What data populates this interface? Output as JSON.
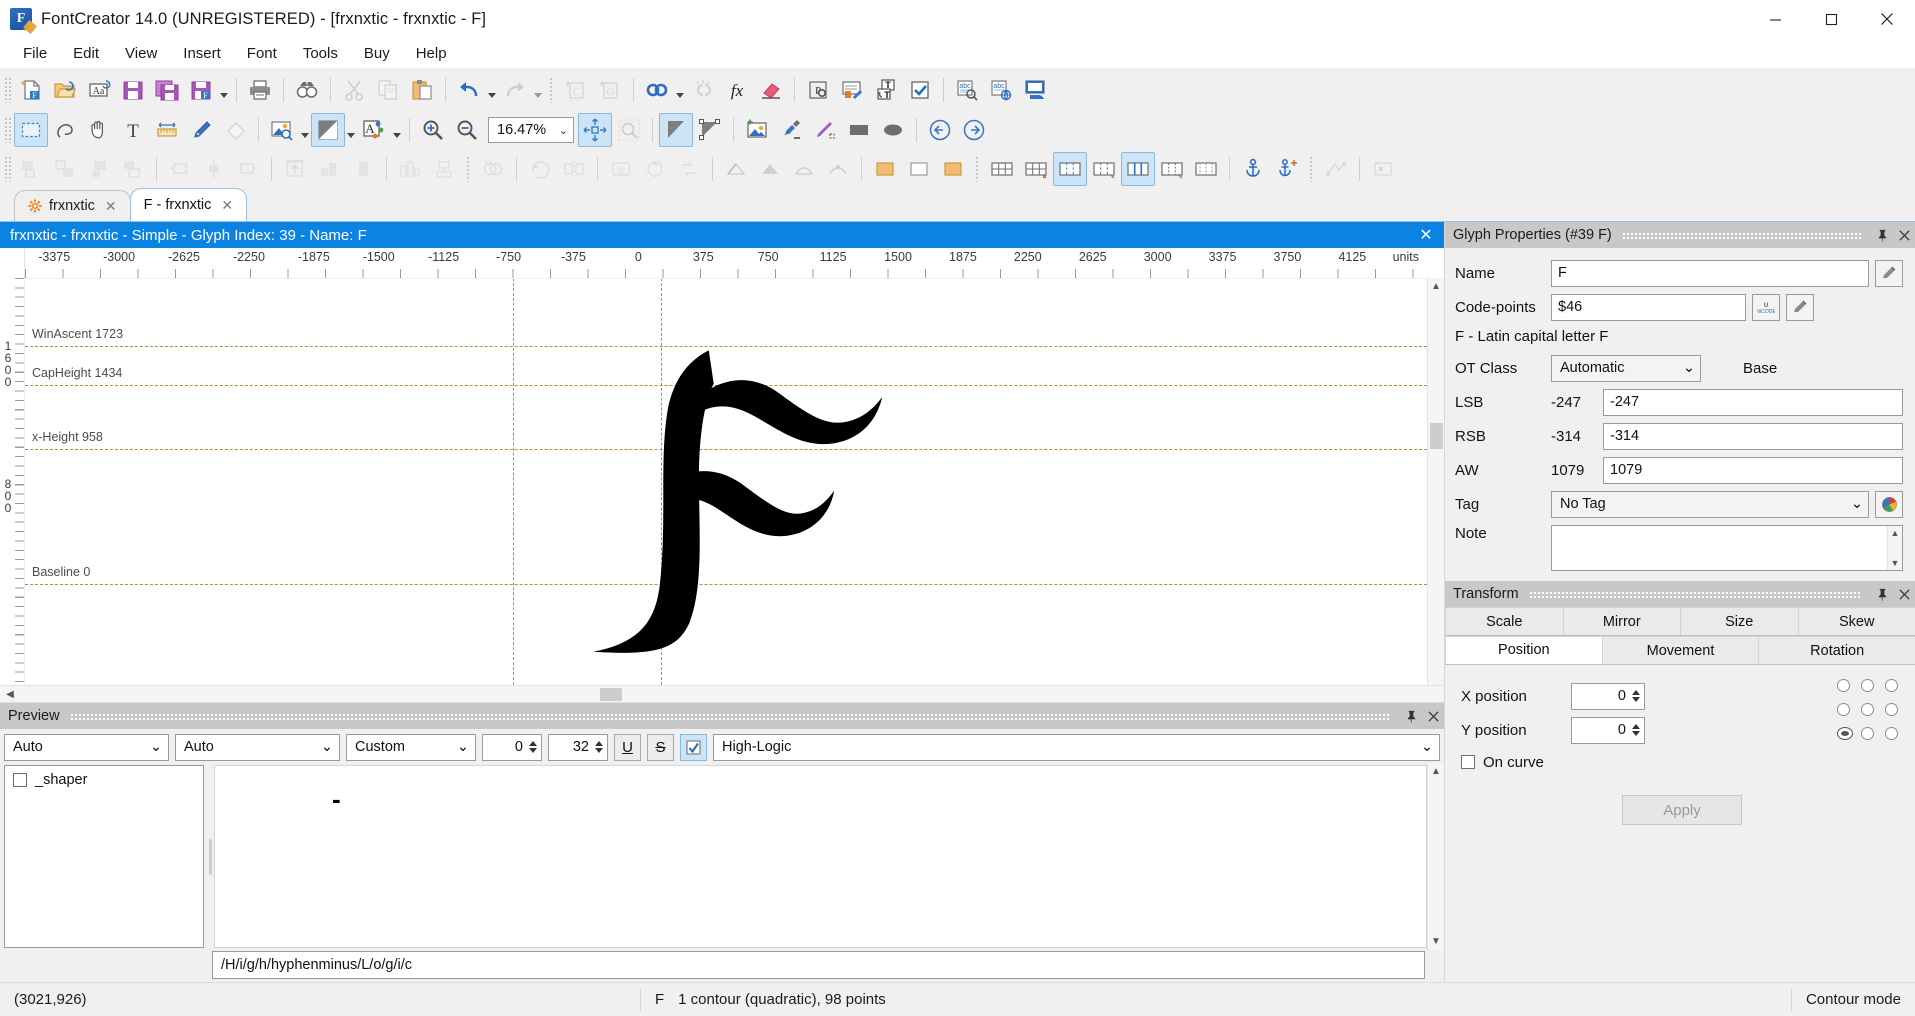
{
  "window": {
    "title": "FontCreator 14.0 (UNREGISTERED) - [frxnxtic - frxnxtic - F]",
    "app_icon": "F",
    "minimize": "minimize-button",
    "maximize": "maximize-button",
    "close": "close-button"
  },
  "menu": [
    "File",
    "Edit",
    "View",
    "Insert",
    "Font",
    "Tools",
    "Buy",
    "Help"
  ],
  "toolbar_row1": [
    {
      "name": "new-font-icon",
      "disabled": false
    },
    {
      "name": "open-font-icon",
      "disabled": false
    },
    {
      "name": "font-name-icon",
      "disabled": false
    },
    {
      "name": "save-icon",
      "disabled": false
    },
    {
      "name": "save-all-icon",
      "disabled": false
    },
    {
      "name": "save-as-icon",
      "disabled": false,
      "dropdown": true
    },
    {
      "sep": true
    },
    {
      "name": "print-icon",
      "disabled": false
    },
    {
      "sep": true
    },
    {
      "name": "find-icon",
      "disabled": false
    },
    {
      "sep": true
    },
    {
      "name": "cut-icon",
      "disabled": true
    },
    {
      "name": "copy-icon",
      "disabled": true
    },
    {
      "name": "paste-icon",
      "disabled": false
    },
    {
      "sep": true
    },
    {
      "name": "undo-icon",
      "disabled": false,
      "dropdown": true
    },
    {
      "name": "redo-icon",
      "disabled": true,
      "dropdown": true
    },
    {
      "sepdot": true
    },
    {
      "name": "add-contour-icon",
      "disabled": true
    },
    {
      "name": "add-glyph-icon",
      "disabled": true
    },
    {
      "sep": true
    },
    {
      "name": "link-icon",
      "disabled": false,
      "dropdown": true
    },
    {
      "name": "unlink-icon",
      "disabled": true
    },
    {
      "name": "function-icon",
      "disabled": false
    },
    {
      "name": "eraser-icon",
      "disabled": false
    },
    {
      "sep": true
    },
    {
      "name": "font-properties-icon",
      "disabled": false
    },
    {
      "name": "edit-metadata-icon",
      "disabled": false
    },
    {
      "name": "transform-text-icon",
      "disabled": false
    },
    {
      "name": "validation-icon",
      "disabled": false
    },
    {
      "sep": true
    },
    {
      "name": "test-font-icon",
      "disabled": false
    },
    {
      "name": "web-preview-icon",
      "disabled": false
    },
    {
      "name": "install-font-icon",
      "disabled": false
    }
  ],
  "toolbar_row2": [
    {
      "name": "select-tool-icon",
      "active": true
    },
    {
      "name": "lasso-tool-icon"
    },
    {
      "name": "pan-tool-icon"
    },
    {
      "name": "text-tool-icon"
    },
    {
      "name": "measure-tool-icon"
    },
    {
      "name": "knife-tool-icon"
    },
    {
      "name": "fill-tool-icon",
      "disabled": true
    },
    {
      "sep": true
    },
    {
      "name": "image-zoom-icon",
      "dropdown": true
    },
    {
      "name": "contrast-icon",
      "active": true,
      "dropdown": true
    },
    {
      "name": "anti-alias-icon",
      "dropdown": true
    },
    {
      "sep": true
    },
    {
      "name": "zoom-in-icon"
    },
    {
      "name": "zoom-out-icon"
    },
    {
      "name": "zoom-combo"
    },
    {
      "name": "fit-to-window-icon",
      "active": true
    },
    {
      "name": "zoom-selection-icon",
      "disabled": true
    },
    {
      "sep": true
    },
    {
      "name": "fill-shape-icon",
      "active": true
    },
    {
      "name": "outline-shape-icon"
    },
    {
      "sep": true
    },
    {
      "name": "insert-image-icon"
    },
    {
      "name": "brush-icon"
    },
    {
      "name": "pen-icon"
    },
    {
      "name": "rectangle-icon"
    },
    {
      "name": "ellipse-icon"
    },
    {
      "sep": true
    },
    {
      "name": "previous-glyph-icon"
    },
    {
      "name": "next-glyph-icon"
    }
  ],
  "toolbar_row3": [
    {
      "name": "align-left-icon",
      "disabled": true
    },
    {
      "name": "align-horizontal-center-icon",
      "disabled": true
    },
    {
      "name": "align-right-icon",
      "disabled": true
    },
    {
      "name": "distribute-horizontal-icon",
      "disabled": true
    },
    {
      "sep": true
    },
    {
      "name": "align-top-icon",
      "disabled": true
    },
    {
      "name": "align-vertical-center-icon",
      "disabled": true
    },
    {
      "name": "align-bottom-icon",
      "disabled": true
    },
    {
      "sep": true
    },
    {
      "name": "move-to-top-icon",
      "disabled": true
    },
    {
      "name": "move-up-icon",
      "disabled": true
    },
    {
      "name": "move-down-icon",
      "disabled": true
    },
    {
      "sep": true
    },
    {
      "name": "distribute-spacing-icon",
      "disabled": true
    },
    {
      "name": "center-on-width-icon",
      "disabled": true
    },
    {
      "sepdot": true
    },
    {
      "name": "overlap-remove-icon",
      "disabled": true
    },
    {
      "sep": true
    },
    {
      "name": "rotate-icon",
      "disabled": true
    },
    {
      "name": "flip-icon",
      "disabled": true
    },
    {
      "sep": true
    },
    {
      "name": "start-point-icon",
      "disabled": true
    },
    {
      "name": "contour-direction-icon",
      "disabled": true
    },
    {
      "name": "reverse-contour-icon",
      "disabled": true
    },
    {
      "name": "set-contour-icon",
      "disabled": true
    },
    {
      "sep": true
    },
    {
      "name": "corner-point-icon",
      "disabled": true
    },
    {
      "name": "smooth-point-icon",
      "disabled": true
    },
    {
      "name": "tangent-point-icon",
      "disabled": true
    },
    {
      "name": "curve-point-icon",
      "disabled": true
    },
    {
      "sep": true
    },
    {
      "name": "add-anchor-icon",
      "disabled": false
    },
    {
      "name": "remove-anchor-icon",
      "disabled": false
    },
    {
      "name": "snap-grid-icon",
      "disabled": false
    },
    {
      "sep": true
    },
    {
      "name": "grid-view-icon"
    },
    {
      "name": "grid-snap-icon"
    },
    {
      "name": "guideline-icon",
      "active": true
    },
    {
      "name": "guideline-add-icon"
    },
    {
      "name": "metrics-icon",
      "active": true
    },
    {
      "name": "metrics-edit-icon"
    },
    {
      "name": "metrics-view-icon"
    },
    {
      "sep": true
    },
    {
      "name": "anchor-tool-icon"
    },
    {
      "name": "anchor-add-icon"
    },
    {
      "sepdot": true
    },
    {
      "name": "hinting-icon",
      "disabled": true
    },
    {
      "sep": true
    },
    {
      "name": "grid-fit-icon",
      "disabled": true
    }
  ],
  "doc_tabs": [
    {
      "label": "frxnxtic",
      "icon": "gear-icon",
      "active": false,
      "closable": true
    },
    {
      "label": "F - frxnxtic",
      "icon": null,
      "active": true,
      "closable": true
    }
  ],
  "glyph_window": {
    "title": "frxnxtic - frxnxtic - Simple - Glyph Index: 39 - Name: F",
    "ruler_units_label": "units",
    "ruler_labels": [
      "-3375",
      "-3000",
      "-2625",
      "-2250",
      "-1875",
      "-1500",
      "-1125",
      "-750",
      "-375",
      "0",
      "375",
      "750",
      "1125",
      "1500",
      "1875",
      "2250",
      "2625",
      "3000",
      "3375",
      "3750",
      "4125"
    ],
    "ruler_vertical_labels": [
      "1600",
      "800"
    ],
    "guides": [
      {
        "label": "WinAscent 1723"
      },
      {
        "label": "CapHeight 1434"
      },
      {
        "label": "x-Height 958"
      },
      {
        "label": "Baseline 0"
      }
    ]
  },
  "preview": {
    "panel_title": "Preview",
    "pin": "pin-icon",
    "close": "close-icon",
    "script_select": "Auto",
    "language_select": "Auto",
    "render_select": "Custom",
    "spin_a": "0",
    "spin_b": "32",
    "underline_label": "U",
    "strikeout_label": "S",
    "checkbox_label": "✓",
    "features_value": "High-Logic",
    "shaper_label": "_shaper",
    "glyph_sequence": "/H/i/g/h/hyphenminus/L/o/g/i/c",
    "preview_text": "-"
  },
  "glyph_properties": {
    "panel_title": "Glyph Properties (#39 F)",
    "pin": "pin-icon",
    "close": "close-icon",
    "name_label": "Name",
    "name_value": "F",
    "codepoints_label": "Code-points",
    "codepoints_value": "$46",
    "unicode_button": "unicode-icon",
    "edit_button": "edit-icon",
    "description": "F - Latin capital letter F",
    "otclass_label": "OT Class",
    "otclass_value": "Automatic",
    "base_label": "Base",
    "lsb_label": "LSB",
    "lsb_readonly": "-247",
    "lsb_value": "-247",
    "rsb_label": "RSB",
    "rsb_readonly": "-314",
    "rsb_value": "-314",
    "aw_label": "AW",
    "aw_readonly": "1079",
    "aw_value": "1079",
    "tag_label": "Tag",
    "tag_value": "No Tag",
    "tag_color_button": "color-palette-icon",
    "note_label": "Note",
    "note_value": ""
  },
  "transform": {
    "panel_title": "Transform",
    "pin": "pin-icon",
    "close": "close-icon",
    "tabs_row1": [
      "Scale",
      "Mirror",
      "Size",
      "Skew"
    ],
    "tabs_row2": [
      "Position",
      "Movement",
      "Rotation"
    ],
    "active_tab": "Position",
    "x_label": "X position",
    "x_value": "0",
    "y_label": "Y position",
    "y_value": "0",
    "oncurve_label": "On curve",
    "apply_label": "Apply"
  },
  "statusbar": {
    "coordinates": "(3021,926)",
    "glyph_letter": "F",
    "contour_info": "1 contour (quadratic), 98 points",
    "mode": "Contour mode"
  },
  "colors": {
    "accent_blue": "#0a84e0",
    "guide_orange": "#c08a3e",
    "panel_header": "#c8c8c8",
    "toolbar_bg": "#f0f0f0"
  }
}
